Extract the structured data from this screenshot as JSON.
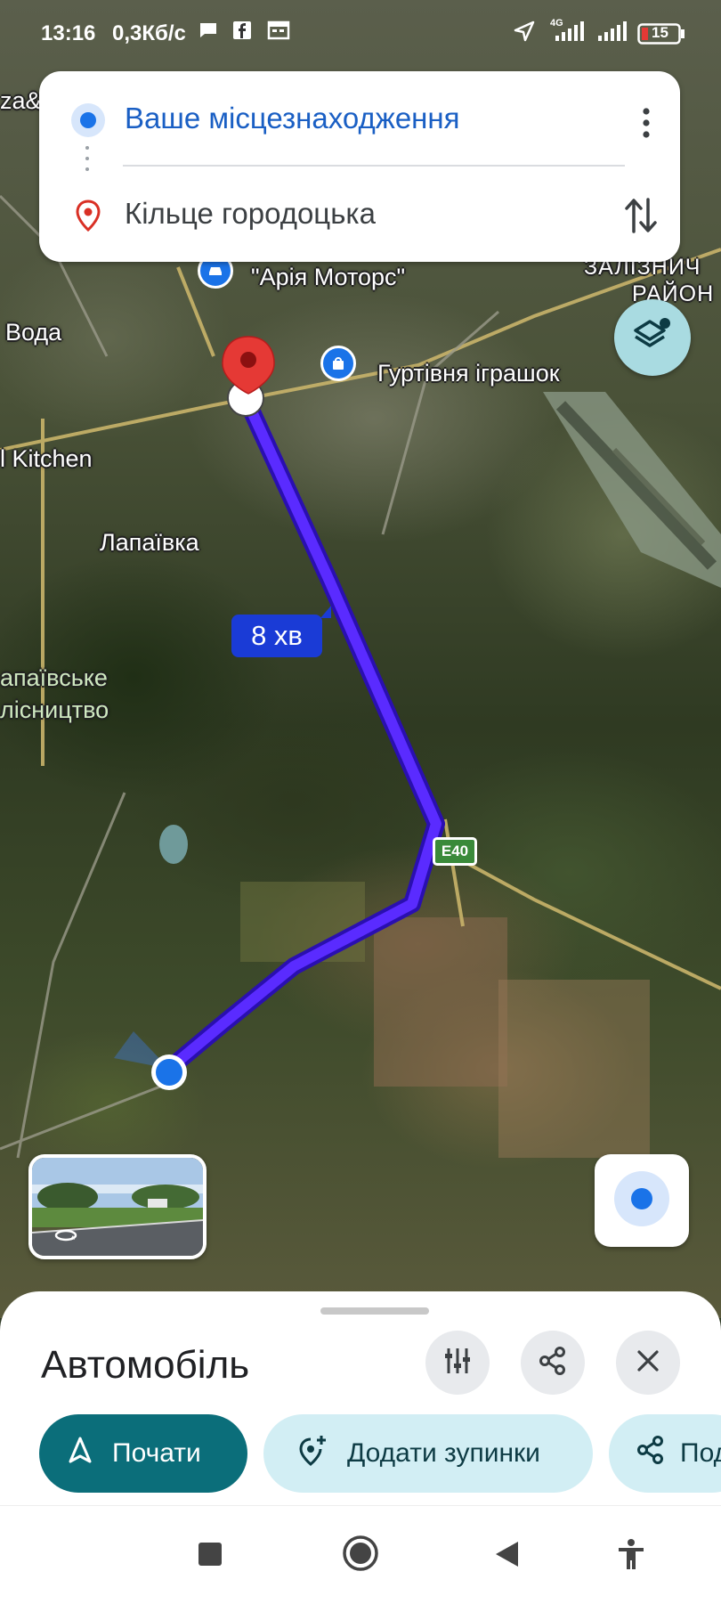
{
  "status_bar": {
    "time": "13:16",
    "network_speed": "0,3Кб/с",
    "battery": "15",
    "network_type": "4G"
  },
  "directions": {
    "origin": "Ваше місцезнаходження",
    "destination": "Кільце городоцька",
    "more_icon": "more-vert-icon",
    "swap_icon": "swap-icon"
  },
  "map": {
    "labels": {
      "top_left": "za&",
      "aria_motors": "\"Арія Моторс\"",
      "district_1": "ЗАЛІЗНИЧ",
      "district_2": "РАЙОН",
      "voda": "Вода",
      "toys": "Гуртівня іграшок",
      "kitchen": "l Kitchen",
      "lapaivka": "Лапаївка",
      "forest_1": "апаївське",
      "forest_2": "лісництво"
    },
    "eta": "8 хв",
    "road_shield": "E40",
    "colors": {
      "route": "#4a1fff",
      "pin": "#d93025",
      "location": "#1a73e8"
    }
  },
  "sheet": {
    "mode": "Автомобіль",
    "start_label": "Почати",
    "add_stops_label": "Додати зупинки",
    "share_label": "Под"
  }
}
